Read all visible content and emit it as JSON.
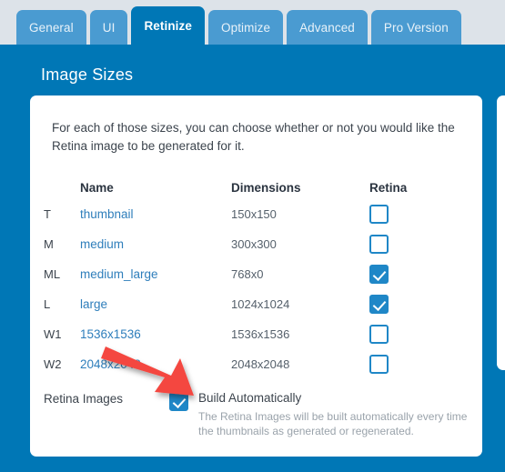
{
  "tabs": [
    {
      "label": "General",
      "active": false
    },
    {
      "label": "UI",
      "active": false
    },
    {
      "label": "Retinize",
      "active": true
    },
    {
      "label": "Optimize",
      "active": false
    },
    {
      "label": "Advanced",
      "active": false
    },
    {
      "label": "Pro Version",
      "active": false
    }
  ],
  "page": {
    "title": "Image Sizes",
    "intro": "For each of those sizes, you can choose whether or not you would like the Retina image to be generated for it."
  },
  "table": {
    "headers": {
      "key": "",
      "name": "Name",
      "dimensions": "Dimensions",
      "retina": "Retina"
    },
    "rows": [
      {
        "key": "T",
        "name": "thumbnail",
        "dimensions": "150x150",
        "retina": false
      },
      {
        "key": "M",
        "name": "medium",
        "dimensions": "300x300",
        "retina": false
      },
      {
        "key": "ML",
        "name": "medium_large",
        "dimensions": "768x0",
        "retina": true
      },
      {
        "key": "L",
        "name": "large",
        "dimensions": "1024x1024",
        "retina": true
      },
      {
        "key": "W1",
        "name": "1536x1536",
        "dimensions": "1536x1536",
        "retina": false
      },
      {
        "key": "W2",
        "name": "2048x2048",
        "dimensions": "2048x2048",
        "retina": false
      }
    ]
  },
  "option": {
    "label": "Retina Images",
    "checked": true,
    "title": "Build Automatically",
    "description": "The Retina Images will be built automatically every time the thumbnails as generated or regenerated."
  },
  "annotation": {
    "arrow_color": "#f5past"
  },
  "colors": {
    "page_background": "#0077b6",
    "tab_inactive": "#4a9bd1",
    "tab_active": "#0077b6",
    "app_background": "#dde3e9",
    "link": "#2e7ebb",
    "checkbox": "#1f87c7",
    "arrow": "#f44336"
  }
}
